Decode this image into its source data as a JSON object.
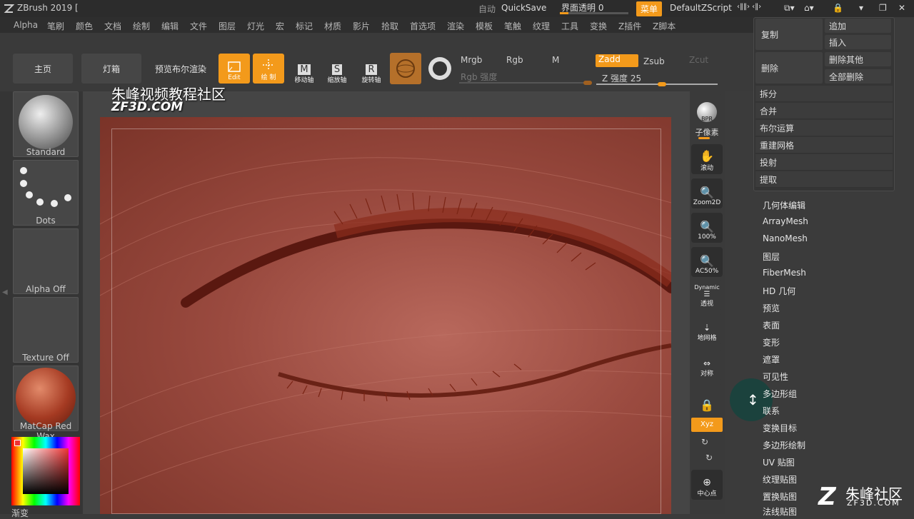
{
  "titlebar": {
    "title": "ZBrush 2019 [",
    "auto": "自动",
    "quicksave": "QuickSave",
    "transparency": "界面透明 0",
    "menu_btn": "菜单",
    "script": "DefaultZScript"
  },
  "menubar": [
    "Alpha",
    "笔刷",
    "颜色",
    "文档",
    "绘制",
    "编辑",
    "文件",
    "图层",
    "灯光",
    "宏",
    "标记",
    "材质",
    "影片",
    "拾取",
    "首选项",
    "渲染",
    "模板",
    "笔触",
    "纹理",
    "工具",
    "变换",
    "Z插件",
    "Z脚本"
  ],
  "toolbar": {
    "home": "主页",
    "lightbox": "灯箱",
    "preview_render": "预览布尔渲染",
    "edit": "Edit",
    "draw": "绘 制",
    "move": "移动轴",
    "scale": "缩放轴",
    "rotate": "旋转轴",
    "mrgb": "Mrgb",
    "rgb": "Rgb",
    "m": "M",
    "rgb_intensity": "Rgb 强度",
    "zadd": "Zadd",
    "zsub": "Zsub",
    "zcut": "Zcut",
    "z_intensity": "Z 强度 25"
  },
  "left": {
    "brush": "Standard",
    "stroke": "Dots",
    "alpha": "Alpha Off",
    "texture": "Texture Off",
    "material": "MatCap Red Wax",
    "gradient": "渐变"
  },
  "watermark": {
    "text": "朱峰视频教程社区",
    "url": "ZF3D.COM",
    "corner": "朱峰社区",
    "corner_url": "ZF3D.COM"
  },
  "rightbar": {
    "bpr": "BPR",
    "subpixel": "子像素",
    "scroll": "滚动",
    "zoom2d": "Zoom2D",
    "zoom100": "100%",
    "ac50": "AC50%",
    "dynamic": "Dynamic",
    "persp": "透视",
    "floor": "地网格",
    "sym": "对称",
    "xyz": "Xyz",
    "center": "中心点"
  },
  "tool_panel": {
    "copy": "复制",
    "append": "追加",
    "insert": "插入",
    "delete": "删除",
    "delete_others": "删除其他",
    "delete_all": "全部删除",
    "rows": [
      "拆分",
      "合并",
      "布尔运算",
      "重建网格",
      "投射",
      "提取"
    ]
  },
  "subtools": [
    "几何体编辑",
    "ArrayMesh",
    "NanoMesh",
    "图层",
    "FiberMesh",
    "HD 几何",
    "预览",
    "表面",
    "变形",
    "遮罩",
    "可见性",
    "多边形组",
    "联系",
    "变换目标",
    "多边形绘制",
    "UV 贴图",
    "纹理贴图",
    "置换贴图",
    "法线贴图"
  ],
  "colors": {
    "accent": "#f39a1b",
    "panel": "#353535"
  }
}
